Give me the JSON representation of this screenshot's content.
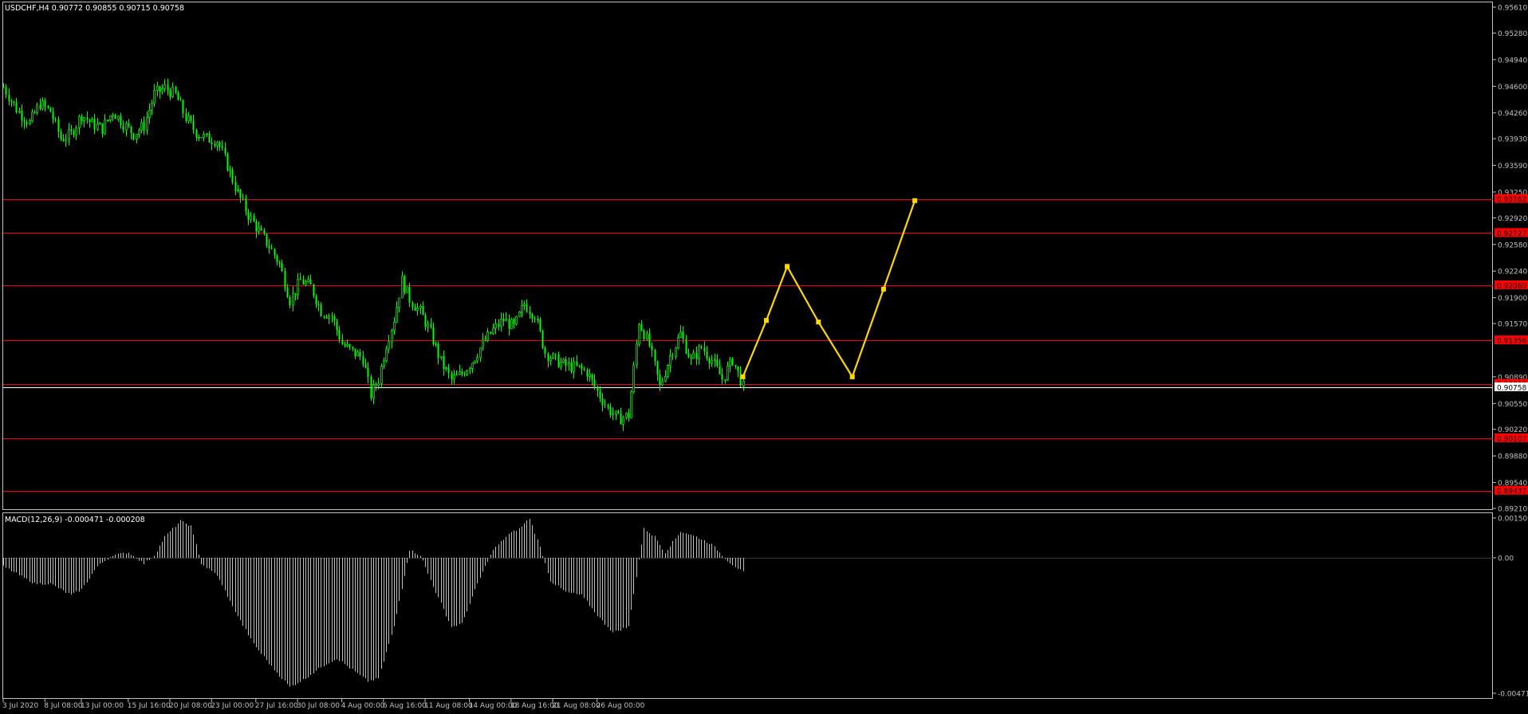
{
  "main_panel": {
    "header": "USDCHF,H4  0.90772 0.90855 0.90715 0.90758",
    "price_axis_labels": [
      "0.95610",
      "0.95280",
      "0.94940",
      "0.94600",
      "0.94260",
      "0.93930",
      "0.93590",
      "0.93250",
      "0.92920",
      "0.92580",
      "0.92240",
      "0.91900",
      "0.91570",
      "0.90890",
      "0.90550",
      "0.90220",
      "0.89880",
      "0.89540",
      "0.89210"
    ],
    "levels": [
      {
        "price": 0.93162,
        "label": "0.93162",
        "color": "#ff0000"
      },
      {
        "price": 0.92727,
        "label": "0.92727",
        "color": "#ff0000"
      },
      {
        "price": 0.9206,
        "label": "0.92060",
        "color": "#ff0000"
      },
      {
        "price": 0.91356,
        "label": "0.91356",
        "color": "#ff0000"
      },
      {
        "price": 0.90802,
        "label": "0.90802",
        "color": "#ff0000"
      },
      {
        "price": 0.90107,
        "label": "0.90107",
        "color": "#ff0000"
      },
      {
        "price": 0.89437,
        "label": "0.89437",
        "color": "#ff0000"
      }
    ],
    "current_price": {
      "price": 0.90758,
      "label": "0.90758",
      "color": "#ffffff"
    },
    "candle_color": "#00ff00",
    "projection_color": "#ffd700"
  },
  "macd_panel": {
    "header": "MACD(12,26,9) -0.000471 -0.000208",
    "axis_labels": [
      "0.001509",
      "0.00",
      "-0.004718"
    ],
    "bar_color": "#c0c0c0"
  },
  "time_axis_labels": [
    "3 Jul 2020",
    "8 Jul 08:00",
    "13 Jul 00:00",
    "15 Jul 16:00",
    "20 Jul 08:00",
    "23 Jul 00:00",
    "27 Jul 16:00",
    "30 Jul 08:00",
    "4 Aug 00:00",
    "6 Aug 16:00",
    "11 Aug 08:00",
    "14 Aug 00:00",
    "18 Aug 16:00",
    "21 Aug 08:00",
    "26 Aug 00:00"
  ],
  "chart_data": {
    "type": "candlestick",
    "symbol": "USDCHF",
    "timeframe": "H4",
    "ylim": [
      0.8921,
      0.9561
    ],
    "close_path": [
      {
        "bar": 0,
        "close": 0.9459
      },
      {
        "bar": 5,
        "close": 0.9431
      },
      {
        "bar": 10,
        "close": 0.9413
      },
      {
        "bar": 14,
        "close": 0.9438
      },
      {
        "bar": 18,
        "close": 0.9428
      },
      {
        "bar": 22,
        "close": 0.9393
      },
      {
        "bar": 26,
        "close": 0.9399
      },
      {
        "bar": 30,
        "close": 0.9424
      },
      {
        "bar": 34,
        "close": 0.9412
      },
      {
        "bar": 38,
        "close": 0.9406
      },
      {
        "bar": 42,
        "close": 0.9428
      },
      {
        "bar": 46,
        "close": 0.9412
      },
      {
        "bar": 50,
        "close": 0.9399
      },
      {
        "bar": 54,
        "close": 0.941
      },
      {
        "bar": 58,
        "close": 0.945
      },
      {
        "bar": 62,
        "close": 0.9458
      },
      {
        "bar": 66,
        "close": 0.9449
      },
      {
        "bar": 70,
        "close": 0.942
      },
      {
        "bar": 74,
        "close": 0.9401
      },
      {
        "bar": 78,
        "close": 0.9393
      },
      {
        "bar": 82,
        "close": 0.9391
      },
      {
        "bar": 86,
        "close": 0.9359
      },
      {
        "bar": 90,
        "close": 0.9323
      },
      {
        "bar": 94,
        "close": 0.9296
      },
      {
        "bar": 98,
        "close": 0.9275
      },
      {
        "bar": 102,
        "close": 0.9256
      },
      {
        "bar": 106,
        "close": 0.9233
      },
      {
        "bar": 110,
        "close": 0.9187
      },
      {
        "bar": 114,
        "close": 0.9212
      },
      {
        "bar": 118,
        "close": 0.9204
      },
      {
        "bar": 122,
        "close": 0.9173
      },
      {
        "bar": 126,
        "close": 0.9167
      },
      {
        "bar": 130,
        "close": 0.9131
      },
      {
        "bar": 134,
        "close": 0.9121
      },
      {
        "bar": 138,
        "close": 0.9113
      },
      {
        "bar": 141,
        "close": 0.9066
      },
      {
        "bar": 144,
        "close": 0.9086
      },
      {
        "bar": 147,
        "close": 0.9131
      },
      {
        "bar": 150,
        "close": 0.9163
      },
      {
        "bar": 153,
        "close": 0.9212
      },
      {
        "bar": 156,
        "close": 0.9188
      },
      {
        "bar": 160,
        "close": 0.9172
      },
      {
        "bar": 164,
        "close": 0.9145
      },
      {
        "bar": 168,
        "close": 0.9108
      },
      {
        "bar": 172,
        "close": 0.9085
      },
      {
        "bar": 176,
        "close": 0.9093
      },
      {
        "bar": 180,
        "close": 0.9109
      },
      {
        "bar": 184,
        "close": 0.9131
      },
      {
        "bar": 188,
        "close": 0.9149
      },
      {
        "bar": 192,
        "close": 0.9162
      },
      {
        "bar": 196,
        "close": 0.9152
      },
      {
        "bar": 200,
        "close": 0.9182
      },
      {
        "bar": 204,
        "close": 0.9168
      },
      {
        "bar": 208,
        "close": 0.912
      },
      {
        "bar": 212,
        "close": 0.911
      },
      {
        "bar": 216,
        "close": 0.9103
      },
      {
        "bar": 220,
        "close": 0.9101
      },
      {
        "bar": 224,
        "close": 0.9095
      },
      {
        "bar": 228,
        "close": 0.907
      },
      {
        "bar": 232,
        "close": 0.9049
      },
      {
        "bar": 236,
        "close": 0.9035
      },
      {
        "bar": 240,
        "close": 0.904
      },
      {
        "bar": 244,
        "close": 0.916
      },
      {
        "bar": 248,
        "close": 0.9129
      },
      {
        "bar": 252,
        "close": 0.9076
      },
      {
        "bar": 256,
        "close": 0.9116
      },
      {
        "bar": 260,
        "close": 0.9144
      },
      {
        "bar": 264,
        "close": 0.9109
      },
      {
        "bar": 268,
        "close": 0.9127
      },
      {
        "bar": 272,
        "close": 0.911
      },
      {
        "bar": 276,
        "close": 0.9086
      },
      {
        "bar": 280,
        "close": 0.9111
      },
      {
        "bar": 284,
        "close": 0.9076
      }
    ],
    "projection": [
      {
        "bar": 284,
        "price": 0.9089
      },
      {
        "bar": 293,
        "price": 0.9161
      },
      {
        "bar": 301,
        "price": 0.923
      },
      {
        "bar": 313,
        "price": 0.9159
      },
      {
        "bar": 326,
        "price": 0.9089
      },
      {
        "bar": 338,
        "price": 0.9201
      },
      {
        "bar": 350,
        "price": 0.9314
      }
    ],
    "macd": [
      {
        "bar": 0,
        "value": -0.0003
      },
      {
        "bar": 6,
        "value": -0.0006
      },
      {
        "bar": 12,
        "value": -0.0009
      },
      {
        "bar": 18,
        "value": -0.0009
      },
      {
        "bar": 26,
        "value": -0.0013
      },
      {
        "bar": 30,
        "value": -0.0011
      },
      {
        "bar": 36,
        "value": -0.0003
      },
      {
        "bar": 42,
        "value": 0.0001
      },
      {
        "bar": 48,
        "value": 0.0002
      },
      {
        "bar": 54,
        "value": -0.0002
      },
      {
        "bar": 58,
        "value": 0.0001
      },
      {
        "bar": 62,
        "value": 0.0008
      },
      {
        "bar": 68,
        "value": 0.0014
      },
      {
        "bar": 72,
        "value": 0.0012
      },
      {
        "bar": 76,
        "value": -0.0002
      },
      {
        "bar": 82,
        "value": -0.0006
      },
      {
        "bar": 88,
        "value": -0.0017
      },
      {
        "bar": 96,
        "value": -0.003
      },
      {
        "bar": 104,
        "value": -0.0039
      },
      {
        "bar": 110,
        "value": -0.0045
      },
      {
        "bar": 116,
        "value": -0.0042
      },
      {
        "bar": 122,
        "value": -0.0038
      },
      {
        "bar": 128,
        "value": -0.0035
      },
      {
        "bar": 134,
        "value": -0.0039
      },
      {
        "bar": 140,
        "value": -0.0043
      },
      {
        "bar": 144,
        "value": -0.0042
      },
      {
        "bar": 150,
        "value": -0.0024
      },
      {
        "bar": 156,
        "value": 0.0003
      },
      {
        "bar": 160,
        "value": 0.0001
      },
      {
        "bar": 166,
        "value": -0.0012
      },
      {
        "bar": 172,
        "value": -0.0024
      },
      {
        "bar": 176,
        "value": -0.0023
      },
      {
        "bar": 182,
        "value": -0.0009
      },
      {
        "bar": 188,
        "value": 0.0003
      },
      {
        "bar": 194,
        "value": 0.0009
      },
      {
        "bar": 198,
        "value": 0.0011
      },
      {
        "bar": 202,
        "value": 0.0015
      },
      {
        "bar": 206,
        "value": 0.0004
      },
      {
        "bar": 210,
        "value": -0.0008
      },
      {
        "bar": 216,
        "value": -0.0012
      },
      {
        "bar": 222,
        "value": -0.0013
      },
      {
        "bar": 228,
        "value": -0.002
      },
      {
        "bar": 234,
        "value": -0.0026
      },
      {
        "bar": 240,
        "value": -0.0024
      },
      {
        "bar": 246,
        "value": 0.0011
      },
      {
        "bar": 250,
        "value": 0.0008
      },
      {
        "bar": 254,
        "value": 0.0002
      },
      {
        "bar": 260,
        "value": 0.001
      },
      {
        "bar": 266,
        "value": 0.0008
      },
      {
        "bar": 272,
        "value": 0.0005
      },
      {
        "bar": 278,
        "value": -0.0001
      },
      {
        "bar": 284,
        "value": -0.0005
      }
    ]
  }
}
